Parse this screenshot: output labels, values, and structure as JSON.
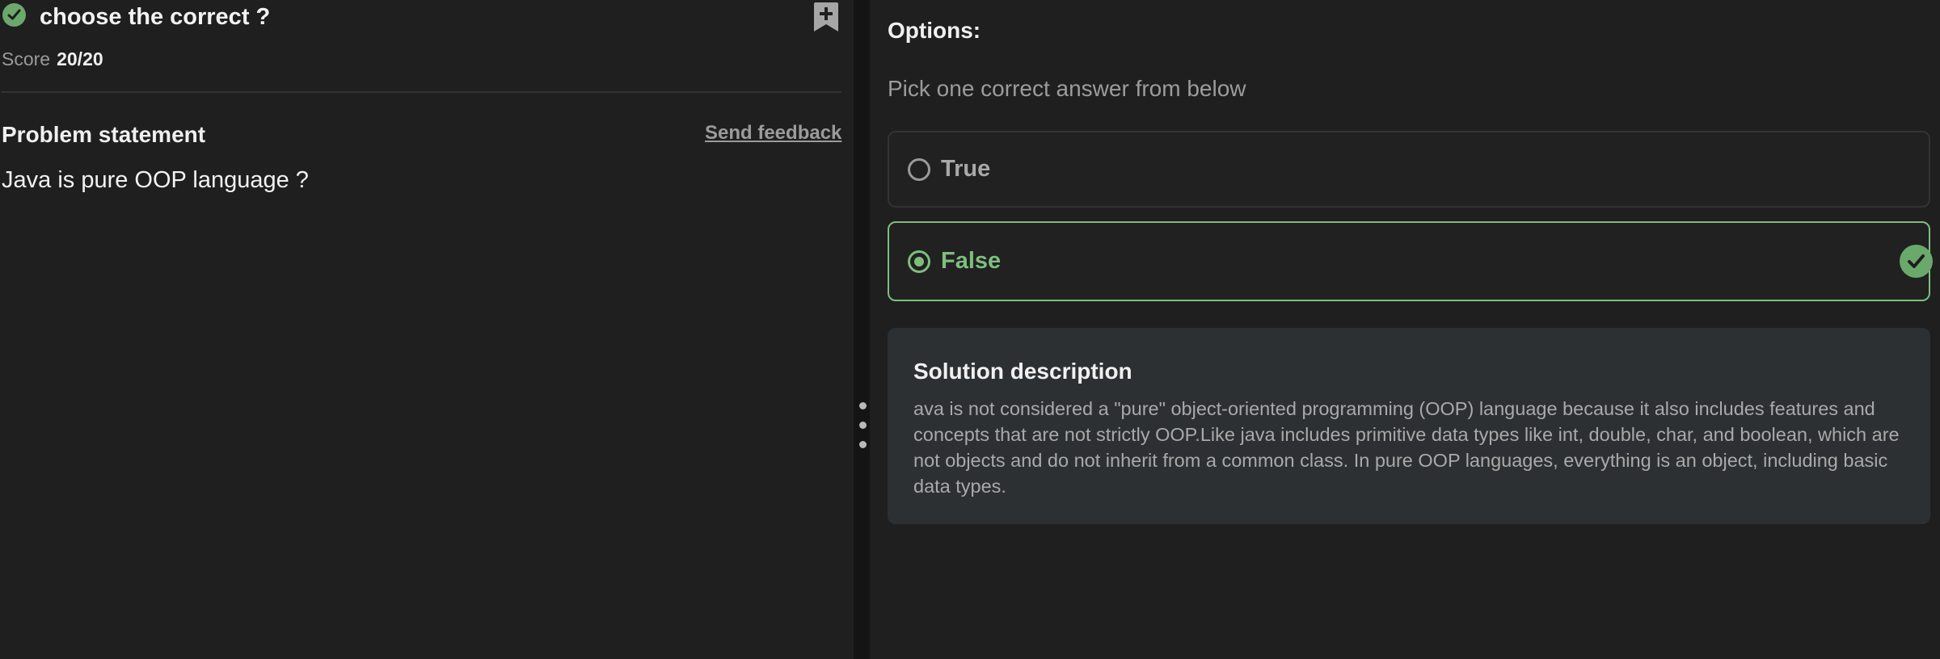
{
  "problem": {
    "title": "choose the correct ?",
    "score_label": "Score",
    "score_value": "20/20",
    "statement_heading": "Problem statement",
    "feedback_link": "Send feedback",
    "statement_text": "Java is pure OOP language ?",
    "status_icon": "check-circle-icon",
    "bookmark_icon": "bookmark-add-icon"
  },
  "options": {
    "heading": "Options:",
    "instruction": "Pick one correct answer from below",
    "items": [
      {
        "label": "True",
        "selected": false,
        "correct": false
      },
      {
        "label": "False",
        "selected": true,
        "correct": true
      }
    ]
  },
  "solution": {
    "heading": "Solution description",
    "text": "ava is not considered a \"pure\" object-oriented programming (OOP) language because it also includes features and concepts that are not strictly OOP.Like java includes primitive data types like int, double, char, and boolean, which are not objects and do not inherit from a common class. In pure OOP languages, everything is an object, including basic data types."
  },
  "colors": {
    "background": "#1f1f1f",
    "accent_green": "#7cbf7d",
    "check_green": "#6aa96b",
    "solution_bg": "#2c3032",
    "splitter": "#141414"
  }
}
